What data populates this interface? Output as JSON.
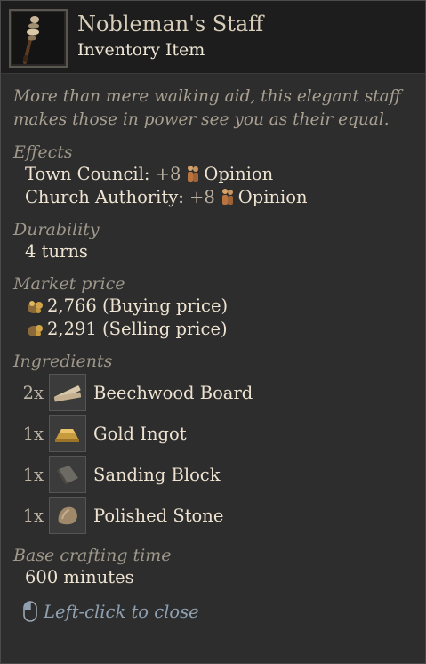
{
  "item": {
    "title": "Nobleman's Staff",
    "subtitle": "Inventory Item",
    "description": "More than mere walking aid, this elegant staff makes those in power see you as their equal."
  },
  "effects": {
    "label": "Effects",
    "items": [
      {
        "target": "Town Council",
        "sep": ":",
        "value": "+8",
        "unit": "Opinion"
      },
      {
        "target": "Church Authority",
        "sep": ":",
        "value": "+8",
        "unit": "Opinion"
      }
    ]
  },
  "durability": {
    "label": "Durability",
    "value": "4 turns"
  },
  "market": {
    "label": "Market price",
    "buying": "2,766 (Buying price)",
    "selling": "2,291 (Selling price)"
  },
  "ingredients": {
    "label": "Ingredients",
    "items": [
      {
        "qty": "2x",
        "name": "Beechwood Board",
        "icon": "beechwood-board-icon"
      },
      {
        "qty": "1x",
        "name": "Gold Ingot",
        "icon": "gold-ingot-icon"
      },
      {
        "qty": "1x",
        "name": "Sanding Block",
        "icon": "sanding-block-icon"
      },
      {
        "qty": "1x",
        "name": "Polished Stone",
        "icon": "polished-stone-icon"
      }
    ]
  },
  "crafting": {
    "label": "Base crafting time",
    "value": "600 minutes"
  },
  "footer": {
    "hint": "Left-click to close",
    "icon": "mouse-icon"
  },
  "colors": {
    "background": "#2d2d2d",
    "header": "#1d1d1d",
    "text": "#eee3d1",
    "hint": "#8fa0b0"
  }
}
